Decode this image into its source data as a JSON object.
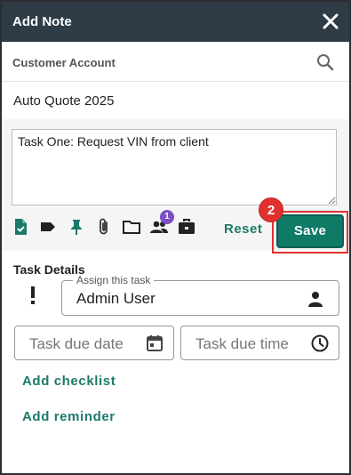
{
  "header": {
    "title": "Add Note",
    "close_icon": "close-icon"
  },
  "account": {
    "label": "Customer Account",
    "search_icon": "search-icon"
  },
  "quote": {
    "name": "Auto Quote 2025"
  },
  "note": {
    "value": "Task One: Request VIN from client"
  },
  "toolbar": {
    "icons": [
      "file-check-icon",
      "tag-icon",
      "pin-icon",
      "paperclip-icon",
      "folder-icon",
      "people-icon",
      "briefcase-icon"
    ],
    "people_badge": "1",
    "reset_label": "Reset",
    "save_label": "Save",
    "step_badge": "2"
  },
  "task_details": {
    "title": "Task Details",
    "priority_icon": "exclamation-icon",
    "assign_legend": "Assign this task",
    "assign_value": "Admin User",
    "assign_icon": "person-icon",
    "due_date_placeholder": "Task due date",
    "due_date_icon": "calendar-icon",
    "due_time_placeholder": "Task due time",
    "due_time_icon": "clock-icon"
  },
  "actions": {
    "add_checklist": "Add checklist",
    "add_reminder": "Add reminder"
  },
  "colors": {
    "header_bg": "#2f3b45",
    "accent_teal": "#0f7a66",
    "highlight_red": "#e0312f",
    "badge_purple": "#7b4fc7"
  }
}
